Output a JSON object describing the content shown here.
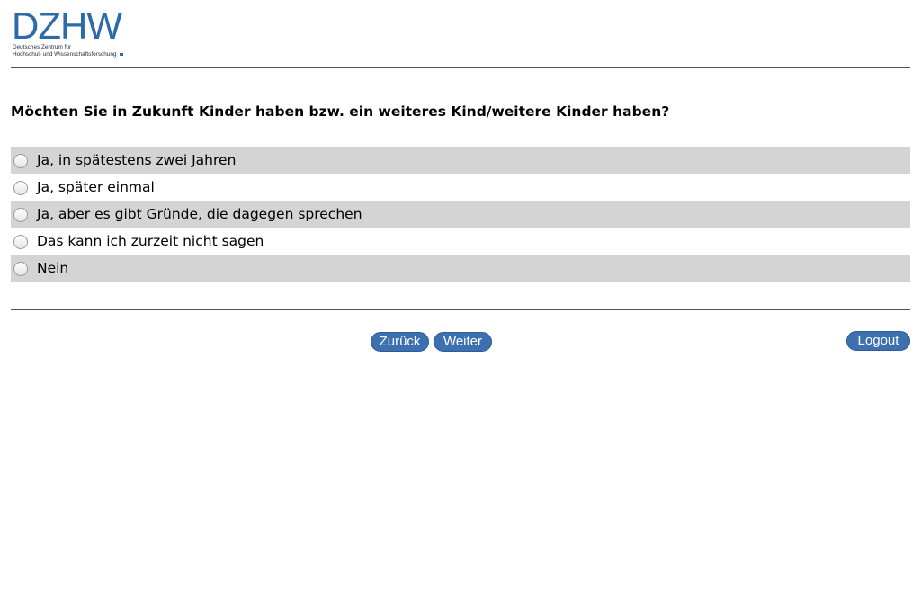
{
  "logo": {
    "mark": "DZHW",
    "line1": "Deutsches Zentrum für",
    "line2": "Hochschul- und Wissenschaftsforschung"
  },
  "question": "Möchten Sie in Zukunft Kinder haben bzw. ein weiteres Kind/weitere Kinder haben?",
  "options": [
    {
      "label": "Ja, in spätestens zwei Jahren"
    },
    {
      "label": "Ja, später einmal"
    },
    {
      "label": "Ja, aber es gibt Gründe, die dagegen sprechen"
    },
    {
      "label": "Das kann ich zurzeit nicht sagen"
    },
    {
      "label": "Nein"
    }
  ],
  "buttons": {
    "back": "Zurück",
    "next": "Weiter",
    "logout": "Logout"
  },
  "colors": {
    "brand": "#2d6aa8",
    "button": "#3c70b0",
    "row_shade": "#d4d4d4"
  }
}
